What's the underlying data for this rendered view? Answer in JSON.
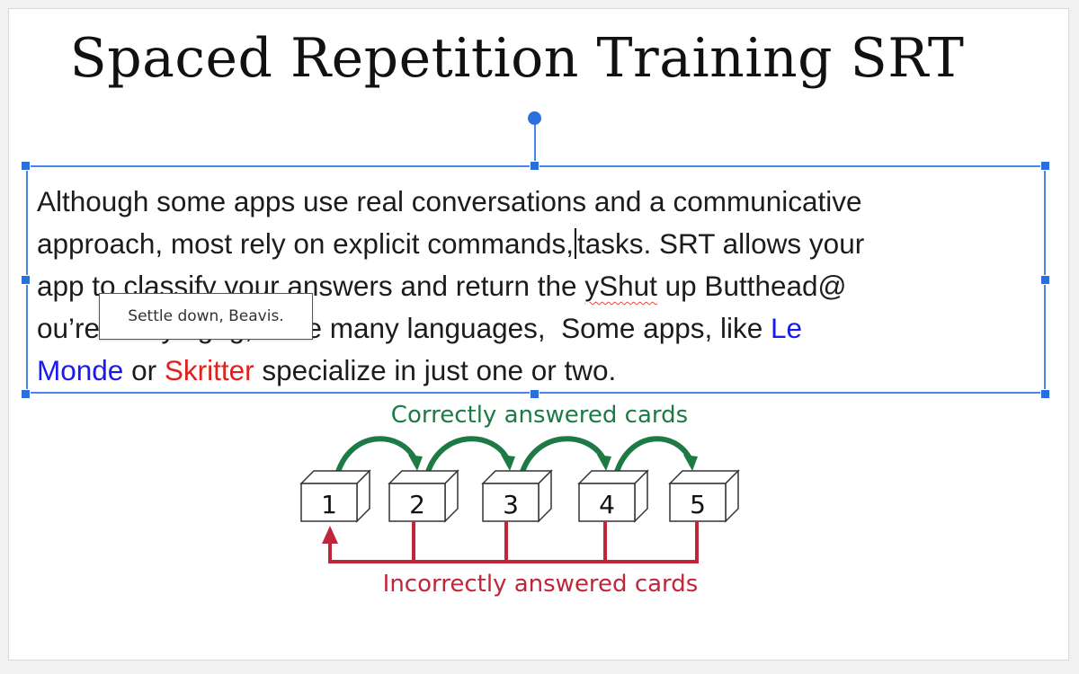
{
  "slide": {
    "title": "Spaced Repetition Training SRT",
    "body": {
      "line1": "Although some apps use real conversations and a communicative",
      "line2_before_caret": "approach, most rely on explicit commands,",
      "line2_after_caret": "tasks. SRT allows your",
      "line3_before": "app to classify your answers and return the ",
      "line3_misspelled": "yShut",
      "line3_after": " up Butthead@",
      "line4_before": "ou’re ",
      "line4_hidden": "studying",
      "line4_after": "ng, have many languages,  Some apps, like ",
      "link_le": "Le",
      "link_monde": "Monde",
      "line5_middle": " or ",
      "link_skritter": "Skritter",
      "line5_after": " specialize in just one or two."
    },
    "tooltip": "Settle down, Beavis."
  },
  "diagram": {
    "top_caption": "Correctly answered cards",
    "bottom_caption": "Incorrectly answered cards",
    "boxes": [
      "1",
      "2",
      "3",
      "4",
      "5"
    ]
  },
  "colors": {
    "selection": "#4a86e8",
    "link_blue": "#1a1af0",
    "link_red": "#e0201b",
    "correct_green": "#1e7a45",
    "incorrect_red": "#c0263a"
  }
}
